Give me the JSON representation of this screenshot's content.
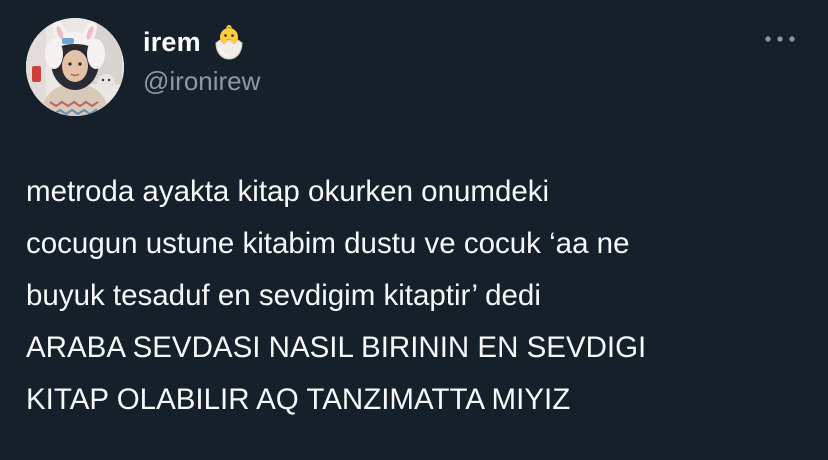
{
  "theme": {
    "background": "#15202b",
    "text_primary": "#f7f9f9",
    "text_secondary": "#8b98a5"
  },
  "author": {
    "display_name": "irem",
    "name_emoji": "hatching-chick-icon",
    "handle": "@ironirew",
    "avatar": "profile-photo"
  },
  "menu": {
    "icon": "more-horizontal-icon"
  },
  "tweet": {
    "lines": [
      "metroda ayakta kitap okurken onumdeki",
      "cocugun ustune kitabim dustu ve cocuk ‘aa ne",
      "buyuk tesaduf en sevdigim kitaptir’ dedi",
      "ARABA SEVDASI NASIL BIRININ EN SEVDIGI",
      "KITAP OLABILIR AQ TANZIMATTA MIYIZ"
    ]
  }
}
